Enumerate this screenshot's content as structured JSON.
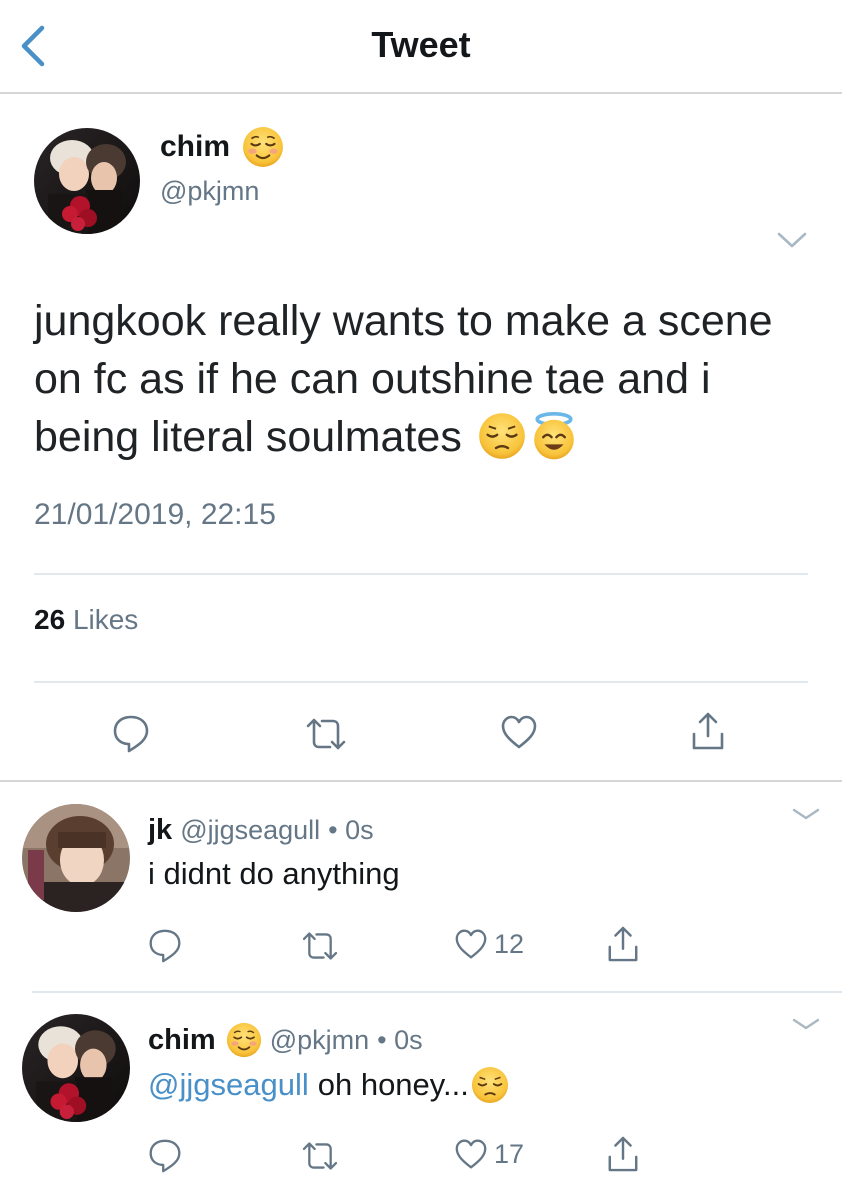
{
  "nav": {
    "title": "Tweet",
    "back_icon": "chevron-left-icon"
  },
  "colors": {
    "accent": "#4a90c8",
    "secondary_text": "#657786",
    "divider": "#e1e8ed"
  },
  "main_tweet": {
    "name": "chim",
    "name_emoji": "smiling-face-icon",
    "handle": "@pkjmn",
    "text": "jungkook really wants to make a scene on fc as if he can outshine tae and i being literal soulmates",
    "text_emojis": [
      "pensive-face-icon",
      "smiling-face-with-halo-icon"
    ],
    "timestamp": "21/01/2019, 22:15",
    "likes_count": "26",
    "likes_label": "Likes"
  },
  "replies": [
    {
      "name": "jk",
      "handle": "@jjgseagull",
      "time": "• 0s",
      "text": "i didnt do anything",
      "like_count": "12"
    },
    {
      "name": "chim",
      "name_emoji": "smiling-face-icon",
      "handle": "@pkjmn",
      "time": "• 0s",
      "mention": "@jjgseagull",
      "text": "oh honey...",
      "text_emoji": "pensive-face-icon",
      "like_count": "17"
    }
  ]
}
